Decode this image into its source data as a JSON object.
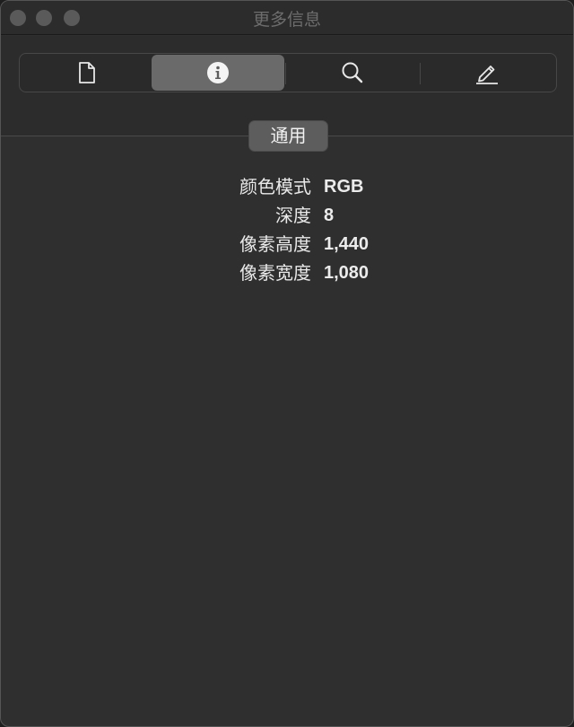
{
  "window": {
    "title": "更多信息"
  },
  "toolbar": {
    "tabs": [
      {
        "icon": "document-icon",
        "active": false
      },
      {
        "icon": "info-icon",
        "active": true
      },
      {
        "icon": "search-icon",
        "active": false
      },
      {
        "icon": "pencil-icon",
        "active": false
      }
    ]
  },
  "section": {
    "button_label": "通用"
  },
  "info": {
    "rows": [
      {
        "label": "颜色模式",
        "value": "RGB"
      },
      {
        "label": "深度",
        "value": "8"
      },
      {
        "label": "像素高度",
        "value": "1,440"
      },
      {
        "label": "像素宽度",
        "value": "1,080"
      }
    ]
  },
  "colors": {
    "background": "#2f2f2f",
    "active_tab": "#6a6a6a",
    "text": "#e9e9e9"
  }
}
